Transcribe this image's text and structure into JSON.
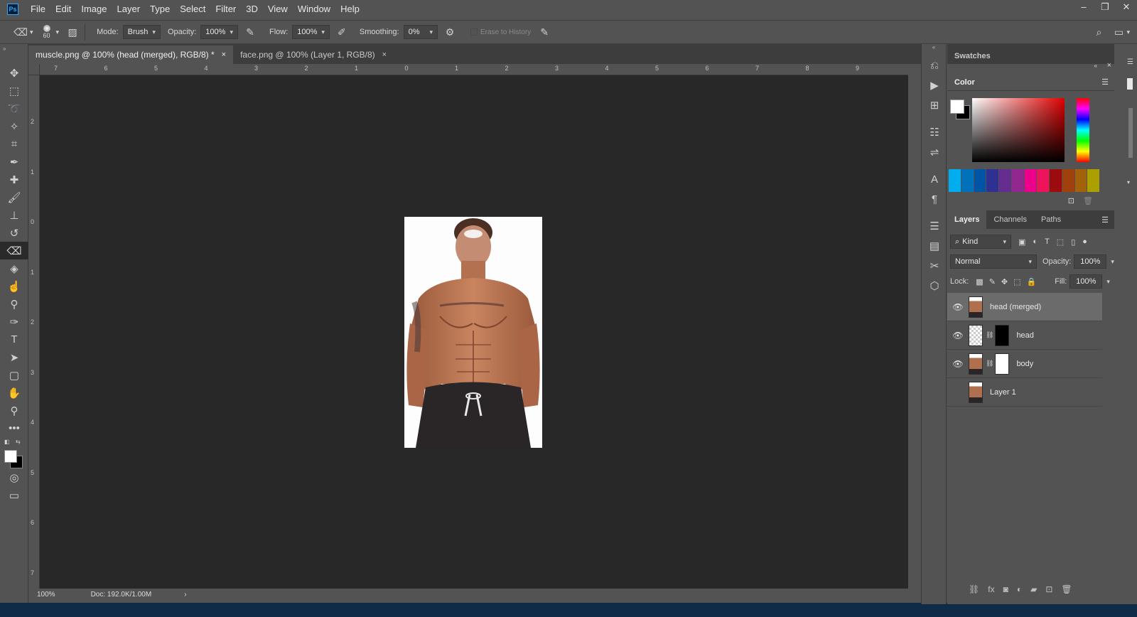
{
  "app": {
    "logo": "Ps"
  },
  "menu": [
    "File",
    "Edit",
    "Image",
    "Layer",
    "Type",
    "Select",
    "Filter",
    "3D",
    "View",
    "Window",
    "Help"
  ],
  "window_controls": {
    "minimize": "–",
    "restore": "❐",
    "close": "✕"
  },
  "options_bar": {
    "brush_size": "60",
    "mode_label": "Mode:",
    "mode_value": "Brush",
    "opacity_label": "Opacity:",
    "opacity_value": "100%",
    "flow_label": "Flow:",
    "flow_value": "100%",
    "smoothing_label": "Smoothing:",
    "smoothing_value": "0%",
    "erase_history_label": "Erase to History"
  },
  "tabs": [
    {
      "title": "muscle.png @ 100% (head (merged), RGB/8) *",
      "close": "×"
    },
    {
      "title": "face.png @ 100% (Layer 1, RGB/8)",
      "close": "×"
    }
  ],
  "ruler": {
    "h": [
      "7",
      "6",
      "5",
      "4",
      "3",
      "2",
      "1",
      "0",
      "1",
      "2",
      "3",
      "4",
      "5",
      "6",
      "7",
      "8",
      "9"
    ],
    "v": [
      "2",
      "1",
      "0",
      "1",
      "2",
      "3",
      "4",
      "5",
      "6",
      "7"
    ]
  },
  "status": {
    "zoom": "100%",
    "doc": "Doc: 192.0K/1.00M"
  },
  "panels": {
    "swatches_tab": "Swatches",
    "color_tab": "Color",
    "layers_tabs": [
      "Layers",
      "Channels",
      "Paths"
    ],
    "kind_label": "Kind",
    "blend_mode": "Normal",
    "opacity_label": "Opacity:",
    "opacity_value": "100%",
    "lock_label": "Lock:",
    "fill_label": "Fill:",
    "fill_value": "100%",
    "layers": [
      {
        "name": "head (merged)",
        "visible": true,
        "selected": true
      },
      {
        "name": "head",
        "visible": true,
        "selected": false
      },
      {
        "name": "body",
        "visible": true,
        "selected": false
      },
      {
        "name": "Layer 1",
        "visible": false,
        "selected": false
      }
    ]
  },
  "colors": {
    "chrome": "#535353",
    "canvas_bg": "#282828",
    "selected_layer": "#6b6b6b"
  }
}
